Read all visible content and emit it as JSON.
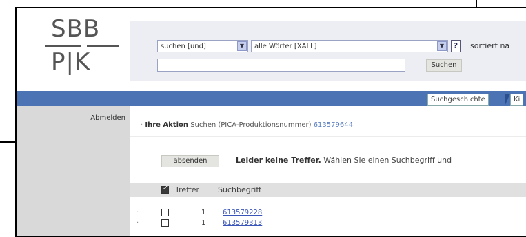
{
  "logo": {
    "top": "SBB",
    "bottom": "P|K"
  },
  "search": {
    "mode_select": "suchen [und]",
    "field_select": "alle Wörter [XALL]",
    "help": "?",
    "sort_label": "sortiert na",
    "query": "",
    "search_button": "Suchen"
  },
  "tabs": [
    {
      "label": "Suchgeschichte"
    },
    {
      "label": "Ki"
    }
  ],
  "sidebar": {
    "logout": "Abmelden"
  },
  "action": {
    "label": "Ihre Aktion",
    "text": "Suchen (PICA-Produktionsnummer)",
    "value": "613579644"
  },
  "submit_button": "absenden",
  "message": {
    "bold": "Leider keine Treffer.",
    "text": "Wählen Sie einen Suchbegriff und"
  },
  "table": {
    "headers": {
      "hits": "Treffer",
      "term": "Suchbegriff"
    },
    "rows": [
      {
        "bullet": "·",
        "hits": "1",
        "term": "613579228"
      },
      {
        "bullet": "·",
        "hits": "1",
        "term": "613579313"
      }
    ]
  }
}
